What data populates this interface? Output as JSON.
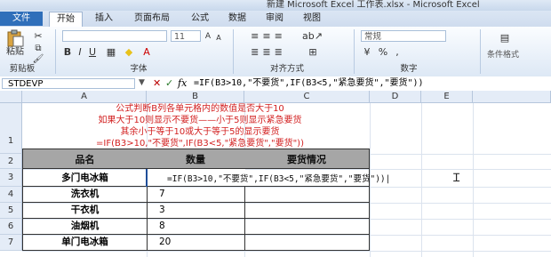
{
  "window": {
    "title": "新建 Microsoft Excel 工作表.xlsx - Microsoft Excel"
  },
  "tabs": [
    {
      "label": "文件"
    },
    {
      "label": "开始"
    },
    {
      "label": "插入"
    },
    {
      "label": "页面布局"
    },
    {
      "label": "公式"
    },
    {
      "label": "数据"
    },
    {
      "label": "审阅"
    },
    {
      "label": "视图"
    }
  ],
  "ribbon": {
    "paste_label": "粘贴",
    "clipboard_group": "剪贴板",
    "font_group": "字体",
    "font_size": "11",
    "font_b": "B",
    "font_i": "I",
    "font_u": "U",
    "align_group": "对齐方式",
    "number_group": "数字",
    "number_format": "常规",
    "percent": "%",
    "comma": ",",
    "styles_label": "条件格式"
  },
  "formula_bar": {
    "name_box": "STDEVP",
    "fx": "fx",
    "formula": "=IF(B3>10,\"不要货\",IF(B3<5,\"紧急要货\",\"要货\"))"
  },
  "columns": [
    "A",
    "B",
    "C",
    "D",
    "E"
  ],
  "rows": [
    "1",
    "2",
    "3",
    "4",
    "5",
    "6",
    "7"
  ],
  "note": {
    "line1": "公式判断B列各单元格内的数值是否大于10",
    "line2": "如果大于10则显示不要货——小于5则显示紧急要货",
    "line3": "其余小于等于10或大于等于5的显示要货",
    "line4": "=IF(B3>10,\"不要货\",IF(B3<5,\"紧急要货\",\"要货\"))"
  },
  "table": {
    "headers": [
      "品名",
      "数量",
      "要货情况"
    ],
    "rows": [
      {
        "name": "多门电冰箱",
        "qty": ""
      },
      {
        "name": "洗衣机",
        "qty": "7"
      },
      {
        "name": "干衣机",
        "qty": "3"
      },
      {
        "name": "油烟机",
        "qty": "8"
      },
      {
        "name": "单门电冰箱",
        "qty": "20"
      }
    ],
    "editing_formula": "=IF(B3>10,\"不要货\",IF(B3<5,\"紧急要货\",\"要货\"))|"
  }
}
